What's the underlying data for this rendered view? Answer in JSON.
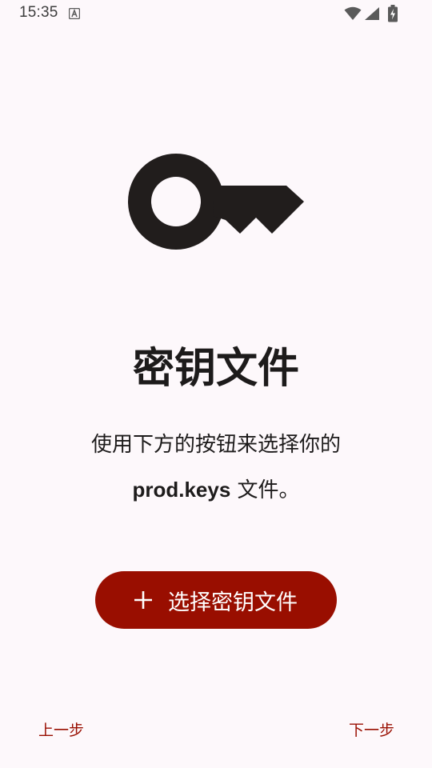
{
  "status_bar": {
    "time": "15:35"
  },
  "main": {
    "title": "密钥文件",
    "description_line1": "使用下方的按钮来选择你的",
    "description_bold": "prod.keys",
    "description_rest": " 文件。"
  },
  "action": {
    "select_key_label": "选择密钥文件"
  },
  "navigation": {
    "back_label": "上一步",
    "next_label": "下一步"
  },
  "colors": {
    "accent": "#990e00",
    "background": "#fdf8fb",
    "text": "#1d1b1b"
  },
  "icons": {
    "hero": "key-icon",
    "button": "plus-icon"
  }
}
